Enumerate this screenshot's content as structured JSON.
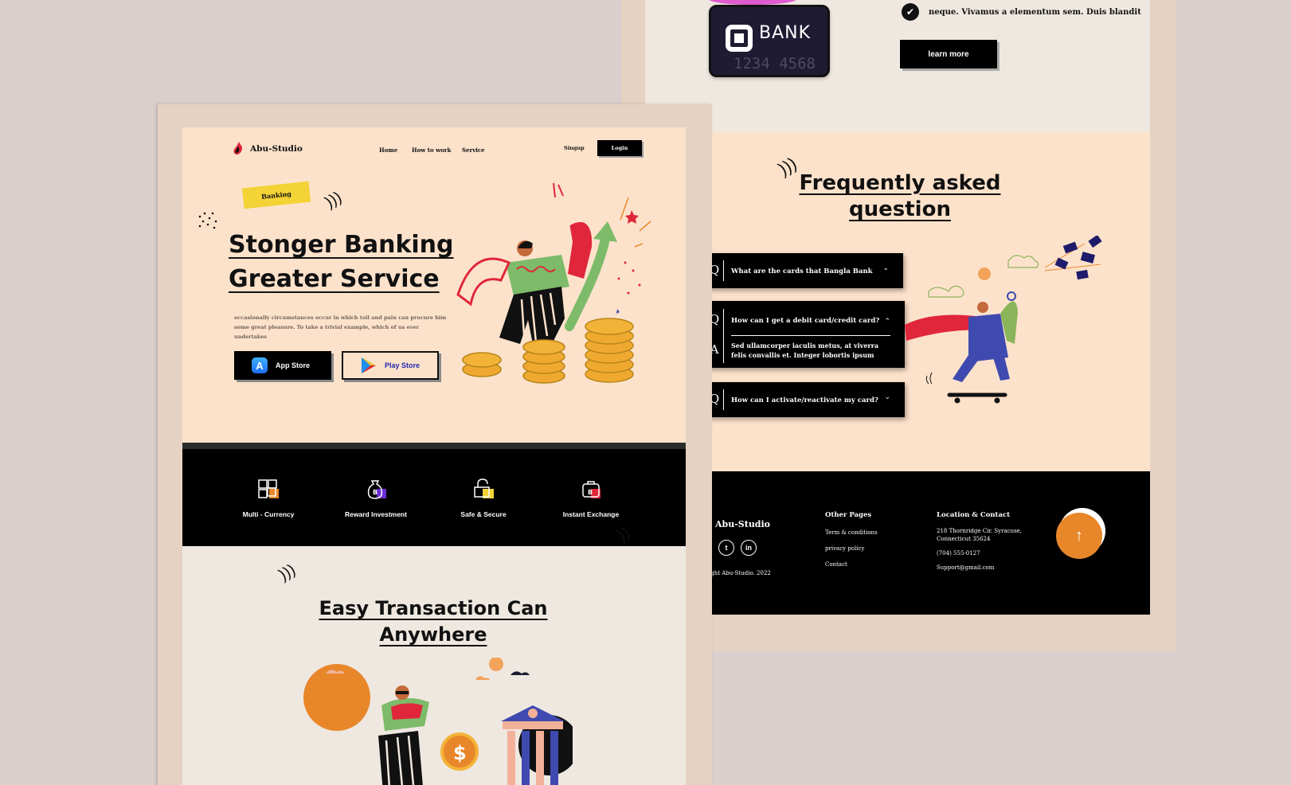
{
  "back": {
    "bank_card": {
      "name": "BANK",
      "number": "1234 4568"
    },
    "feature_check": "neque. Vivamus a elementum sem. Duis blandit",
    "learn_more": "learn more",
    "faq": {
      "title": "Frequently asked question",
      "items": [
        {
          "q_letter": "Q",
          "question": "What are the cards that  Bangla Bank",
          "chevron": "⌄"
        },
        {
          "q_letter": "Q",
          "question": "How can I get a debit card/credit card?",
          "chevron": "⌃",
          "a_letter": "A",
          "answer": "Sed ullamcorper iaculis metus, at viverra felis convallis et. Integer lobortis ipsum"
        },
        {
          "q_letter": "Q",
          "question": "How can I activate/reactivate my card?",
          "chevron": "⌄"
        }
      ]
    },
    "footer": {
      "brand": "Abu-Studio",
      "copyright": "ight Abu-Studio. 2022",
      "other_pages_title": "Other Pages",
      "other_pages": [
        "Term & conditions",
        "privacy policy",
        "Contact"
      ],
      "location_title": "Location & Contact",
      "address_line1": "218 Thornridge Cir. Syracuse,",
      "address_line2": "Connecticut 35624",
      "phone": "(704) 555-0127",
      "email": "Support@gmail.com",
      "socials": [
        "twitter-icon",
        "linkedin-icon"
      ]
    }
  },
  "front": {
    "nav": {
      "brand": "Abu-Studio",
      "links": [
        "Home",
        "How to work",
        "Service"
      ],
      "signup": "Singup",
      "login": "Login"
    },
    "hero": {
      "tag": "Banking",
      "title_line1": "Stonger Banking",
      "title_line2": "Greater Service",
      "description": "occasionally circumstances occur in which toil and pain can procure him some great pleasure. To take a trivial example, which of us ever undertakes",
      "app_store": "App Store",
      "play_store": "Play Store"
    },
    "features": [
      {
        "label": "Multi - Currency",
        "icon": "currency-exchange-icon",
        "accent": "#e8872a"
      },
      {
        "label": "Reward Investment",
        "icon": "money-bag-icon",
        "accent": "#6a2fd6"
      },
      {
        "label": "Safe & Secure",
        "icon": "lock-icon",
        "accent": "#f3d335"
      },
      {
        "label": "Instant Exchange",
        "icon": "briefcase-icon",
        "accent": "#e0263a"
      }
    ],
    "easy": {
      "title_line1": "Easy Transaction Can",
      "title_line2": "Anywhere"
    }
  },
  "colors": {
    "background": "#d9cfcd",
    "frame": "#e6d2c2",
    "hero_peach": "#fde2cb",
    "cream": "#efe8e0",
    "accent_orange": "#e8872a",
    "accent_yellow": "#f3d335",
    "black": "#000000"
  }
}
